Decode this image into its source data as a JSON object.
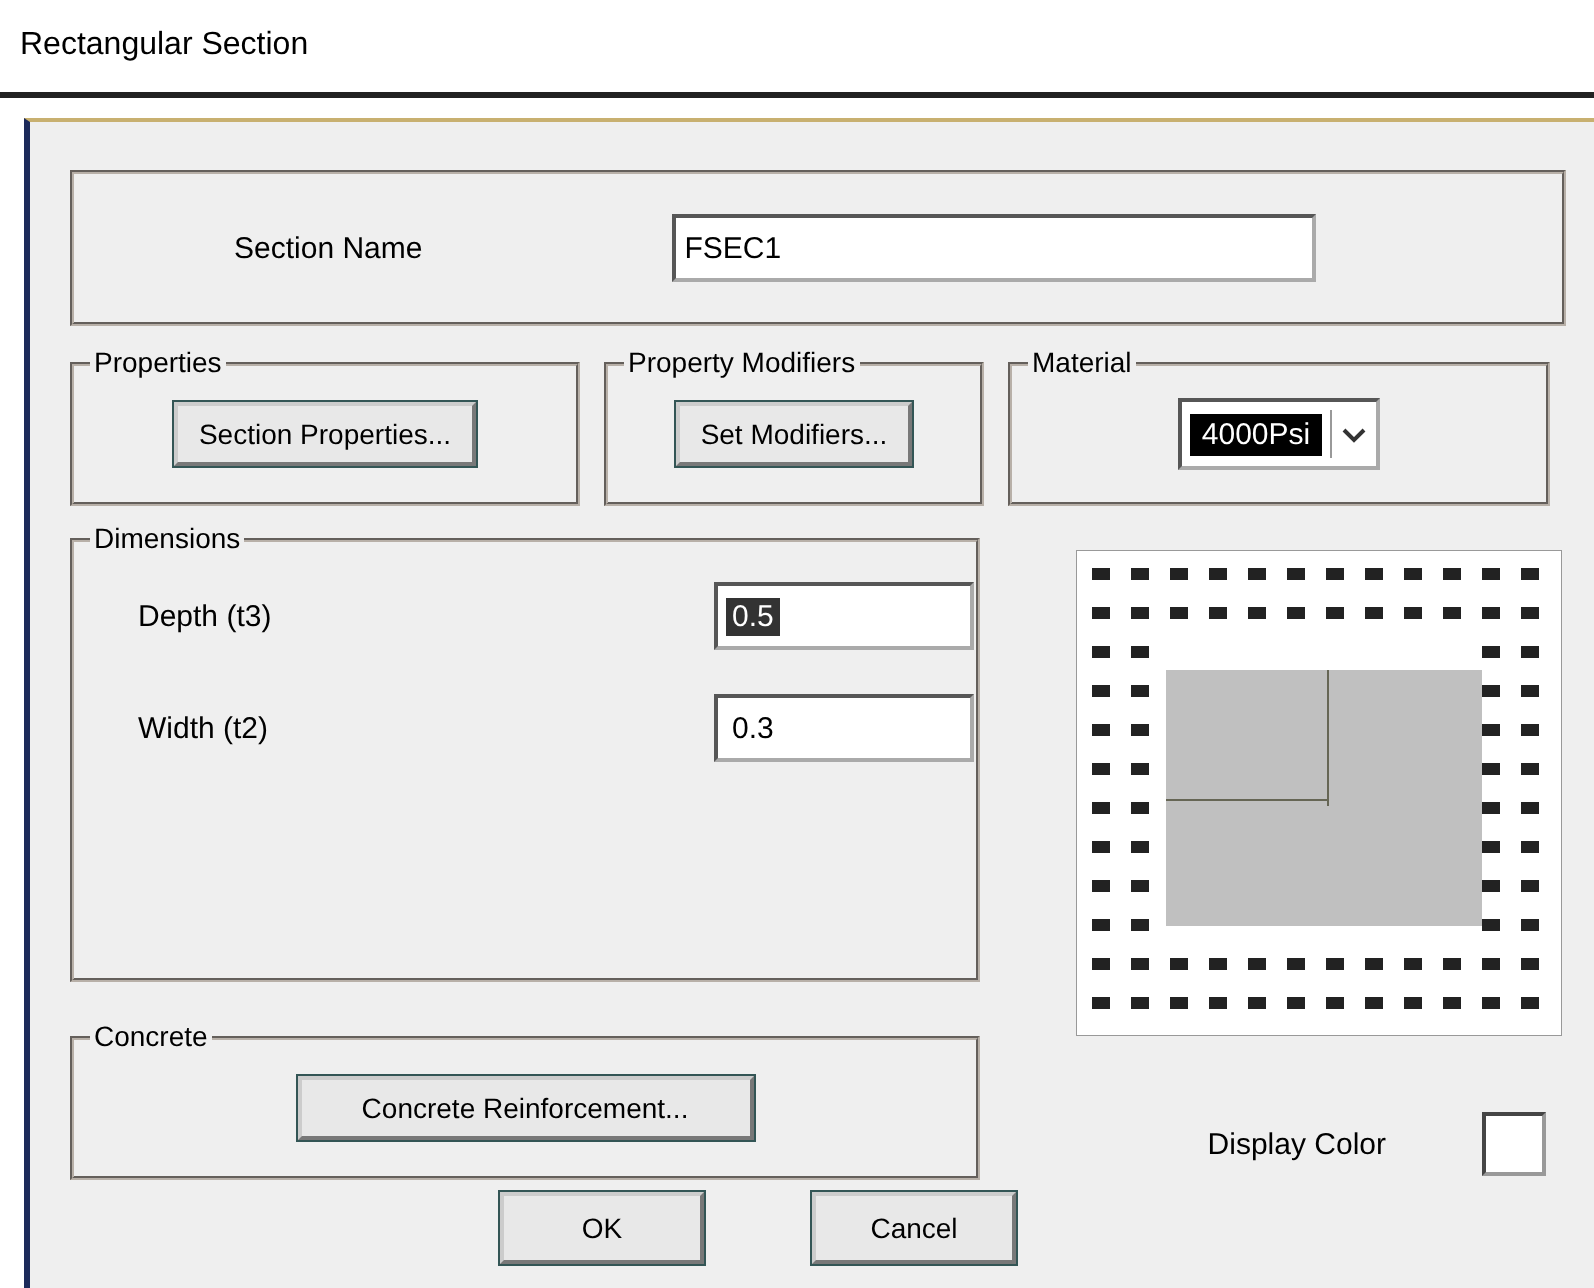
{
  "window": {
    "title": "Rectangular Section"
  },
  "section_name": {
    "label": "Section Name",
    "value": "FSEC1"
  },
  "properties": {
    "title": "Properties",
    "button": "Section Properties..."
  },
  "property_modifiers": {
    "title": "Property Modifiers",
    "button": "Set Modifiers..."
  },
  "material": {
    "title": "Material",
    "value": "4000Psi"
  },
  "dimensions": {
    "title": "Dimensions",
    "fields": [
      {
        "label": "Depth (t3)",
        "value": "0.5",
        "selected": true
      },
      {
        "label": "Width (t2)",
        "value": "0.3",
        "selected": false
      }
    ]
  },
  "concrete": {
    "title": "Concrete",
    "button": "Concrete Reinforcement..."
  },
  "display_color": {
    "label": "Display Color",
    "color": "#ffffff"
  },
  "buttons": [
    "OK",
    "Cancel"
  ]
}
